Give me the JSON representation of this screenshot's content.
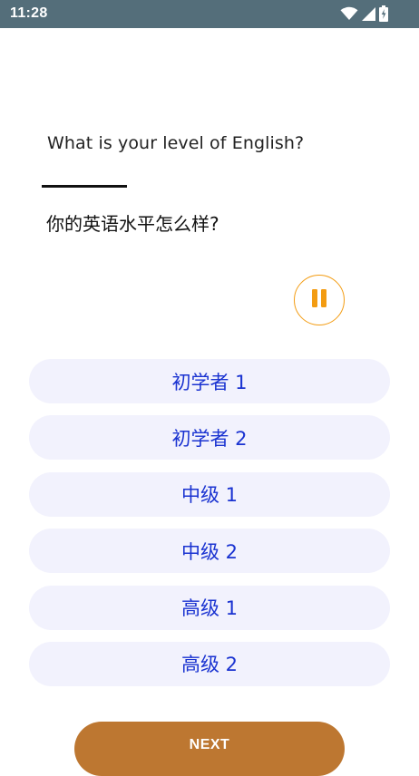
{
  "status_bar": {
    "time": "11:28",
    "icons": [
      "wifi-icon",
      "signal-icon",
      "battery-charging-icon"
    ],
    "color": "#546e7a"
  },
  "question": {
    "english": "What is your level of English?",
    "chinese": "你的英语水平怎么样?"
  },
  "audio": {
    "state_icon": "pause-icon",
    "accent_color": "#f39c12"
  },
  "options": [
    {
      "label": "初学者 1"
    },
    {
      "label": "初学者 2"
    },
    {
      "label": "中级 1"
    },
    {
      "label": "中级 2"
    },
    {
      "label": "高级 1"
    },
    {
      "label": "高级 2"
    }
  ],
  "option_style": {
    "background": "#f2f2fd",
    "text_color": "#1a33d1"
  },
  "next_button": {
    "label": "NEXT",
    "color": "#bd7731"
  }
}
